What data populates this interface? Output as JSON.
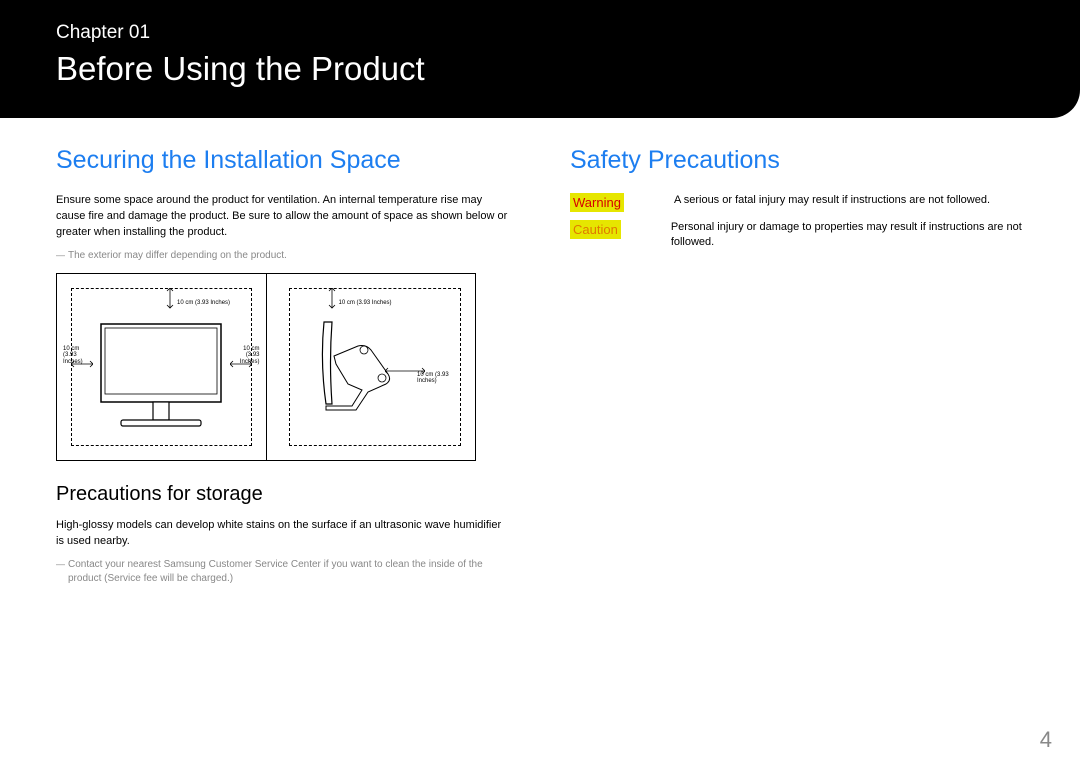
{
  "header": {
    "chapter_label": "Chapter 01",
    "chapter_title": "Before Using the Product"
  },
  "left": {
    "title": "Securing the Installation Space",
    "body1": "Ensure some space around the product for ventilation. An internal temperature rise may cause fire and damage the product. Be sure to allow the amount of space as shown below or greater when installing the product.",
    "note1": "The exterior may differ depending on the product.",
    "diagram": {
      "front_top": "10 cm (3.93 Inches)",
      "front_left": "10 cm (3.93 Inches)",
      "front_right": "10 cm (3.93 Inches)",
      "side_top": "10 cm (3.93 Inches)",
      "side_back": "10 cm (3.93 Inches)"
    },
    "sub_title": "Precautions for storage",
    "body2": "High-glossy models can develop white stains on the surface if an ultrasonic wave humidifier is used nearby.",
    "note2": "Contact your nearest Samsung Customer Service Center if you want to clean the inside of the product (Service fee will be charged.)"
  },
  "right": {
    "title": "Safety Precautions",
    "warning_label": "Warning",
    "warning_text": "A serious or fatal injury may result if instructions are not followed.",
    "caution_label": "Caution",
    "caution_text": "Personal injury or damage to properties may result if instructions are not followed."
  },
  "page_number": "4"
}
